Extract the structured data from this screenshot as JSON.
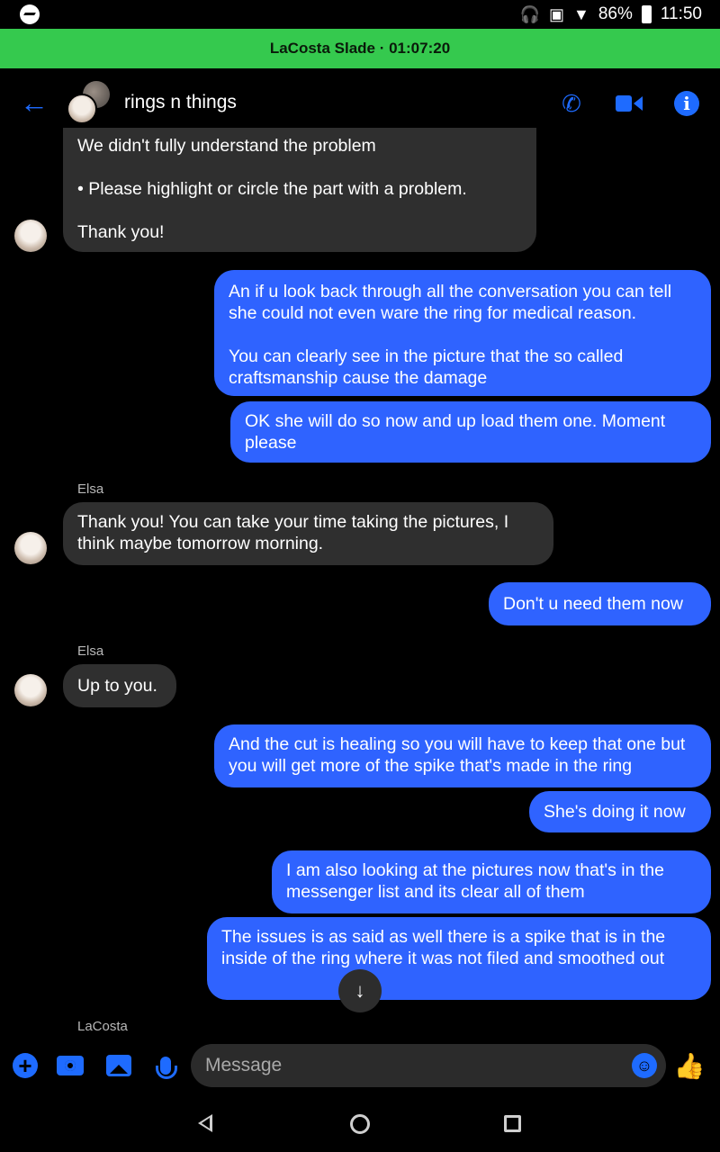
{
  "status_bar": {
    "battery_percent": "86%",
    "time": "11:50",
    "icons": [
      "messenger-icon",
      "headphones-icon",
      "cast-icon",
      "wifi-icon",
      "battery-icon"
    ]
  },
  "call_banner": {
    "text": "LaCosta Slade · 01:07:20",
    "color": "#35c94e"
  },
  "header": {
    "title": "rings n things",
    "accent": "#1e6bff"
  },
  "messages": [
    {
      "side": "in",
      "text": "We didn't fully understand the problem\n\n• Please highlight or circle the part with a problem.\n\nThank you!"
    },
    {
      "side": "out",
      "text": "An if u look back through all the conversation you can tell she could not even ware the ring for medical reason.\n\nYou can clearly see in the picture that the so called craftsmanship cause the damage"
    },
    {
      "side": "out",
      "text": "OK she will do so now and up load them one. Moment please"
    },
    {
      "side": "in",
      "sender": "Elsa",
      "text": "Thank you! You can take your time taking the pictures, I think maybe tomorrow morning."
    },
    {
      "side": "out",
      "text": "Don't u need them now"
    },
    {
      "side": "in",
      "sender": "Elsa",
      "text": "Up to you."
    },
    {
      "side": "out",
      "text": "And the cut is healing so you will have to keep that one but you will get more of the spike that's made in the ring"
    },
    {
      "side": "out",
      "text": "She's doing it now"
    },
    {
      "side": "out",
      "text": "I am also looking at the pictures now that's in the messenger list and its clear all of them"
    },
    {
      "side": "out",
      "text": "The issues is as said as well there is a spike that is in the inside of the ring where it was not filed and smoothed out"
    }
  ],
  "typing_label": "LaCosta",
  "composer": {
    "placeholder": "Message"
  },
  "colors": {
    "outgoing_bubble": "#2f63ff",
    "incoming_bubble": "#2f2f2f",
    "background": "#000000"
  }
}
